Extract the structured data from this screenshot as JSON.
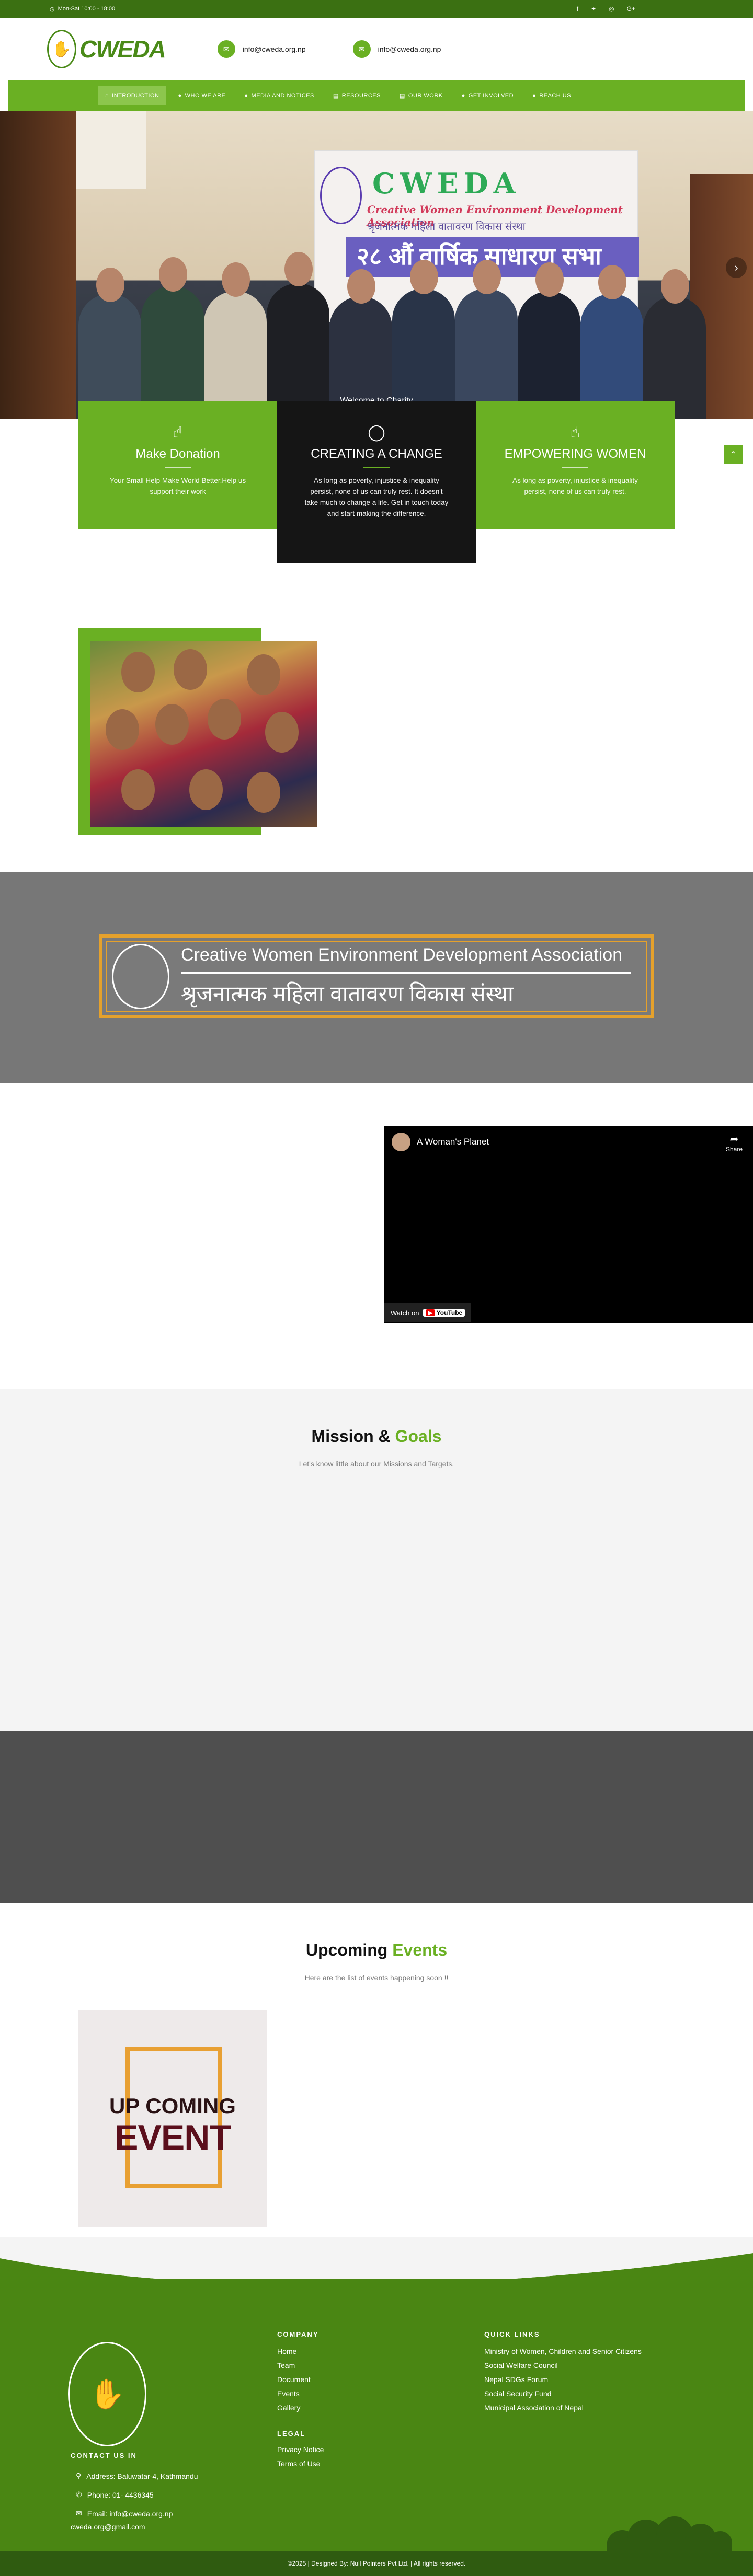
{
  "topbar": {
    "hours": "Mon-Sat 10:00 - 18:00",
    "social": [
      "f",
      "𝕏",
      "⊕",
      "G+"
    ]
  },
  "header": {
    "logo_text": "CWEDA",
    "email1": "info@cweda.org.np",
    "email2": "info@cweda.org.np"
  },
  "nav": {
    "items": [
      {
        "label": "INTRODUCTION",
        "icon": "home-icon"
      },
      {
        "label": "WHO WE ARE",
        "icon": "user-icon"
      },
      {
        "label": "MEDIA AND NOTICES",
        "icon": "user-icon"
      },
      {
        "label": "RESOURCES",
        "icon": "document-icon"
      },
      {
        "label": "OUR WORK",
        "icon": "document-icon"
      },
      {
        "label": "GET INVOLVED",
        "icon": "user-icon"
      },
      {
        "label": "REACH US",
        "icon": "user-icon"
      }
    ]
  },
  "hero": {
    "banner_title": "CWEDA",
    "banner_subtitle": "Creative Women Environment Development Association",
    "banner_nepali": "श्रृजनात्मक महिला वातावरण विकास संस्था",
    "banner_event": "२८ औं वार्षिक साधारण सभा",
    "caption": "Welcome to Charity"
  },
  "features": [
    {
      "title": "Make Donation",
      "text": "Your Small Help Make World Better.Help us support their work",
      "icon": "hands-icon"
    },
    {
      "title": "CREATING A CHANGE",
      "text": "As long as poverty, injustice & inequality persist, none of us can truly rest. It doesn't take much to change a life. Get in touch today and start making the difference.",
      "icon": "donation-icon"
    },
    {
      "title": "EMPOWERING WOMEN",
      "text": "As long as poverty, injustice & inequality persist, none of us can truly rest.",
      "icon": "hands-icon"
    }
  ],
  "cweda_banner": {
    "english": "Creative Women Environment Development Association",
    "nepali": "श्रृजनात्मक महिला वातावरण विकास संस्था"
  },
  "video": {
    "title": "A Woman's Planet",
    "share": "Share",
    "watch_on": "Watch on",
    "youtube": "YouTube"
  },
  "mission": {
    "title_a": "Mission &",
    "title_b": "Goals",
    "subtitle": "Let's know little about our Missions and Targets."
  },
  "events": {
    "title_a": "Upcoming",
    "title_b": "Events",
    "subtitle": "Here are the list of events happening soon !!",
    "card_line1": "UP COMING",
    "card_line2": "EVENT"
  },
  "footer": {
    "company_heading": "COMPANY",
    "company_links": [
      "Home",
      "Team",
      "Document",
      "Events",
      "Gallery"
    ],
    "legal_heading": "LEGAL",
    "legal_links": [
      "Privacy Notice",
      "Terms of Use"
    ],
    "quick_heading": "QUICK LINKS",
    "quick_links": [
      "Ministry of Women, Children and Senior Citizens",
      "Social Welfare Council",
      "Nepal SDGs Forum",
      "Social Security Fund",
      "Municipal Association of Nepal"
    ],
    "contact_heading": "CONTACT US IN",
    "address": "Address: Baluwatar-4, Kathmandu",
    "phone": "Phone: 01- 4436345",
    "email": "Email: info@cweda.org.np",
    "email2": "cweda.org@gmail.com",
    "copyright": "©2025 | Designed By: Null Pointers Pvt Ltd. | All rights reserved."
  },
  "colors": {
    "brand_green": "#6ab023",
    "dark_green": "#3b7012",
    "footer_green": "#4a8613",
    "banner_gold": "#e5a12c"
  }
}
